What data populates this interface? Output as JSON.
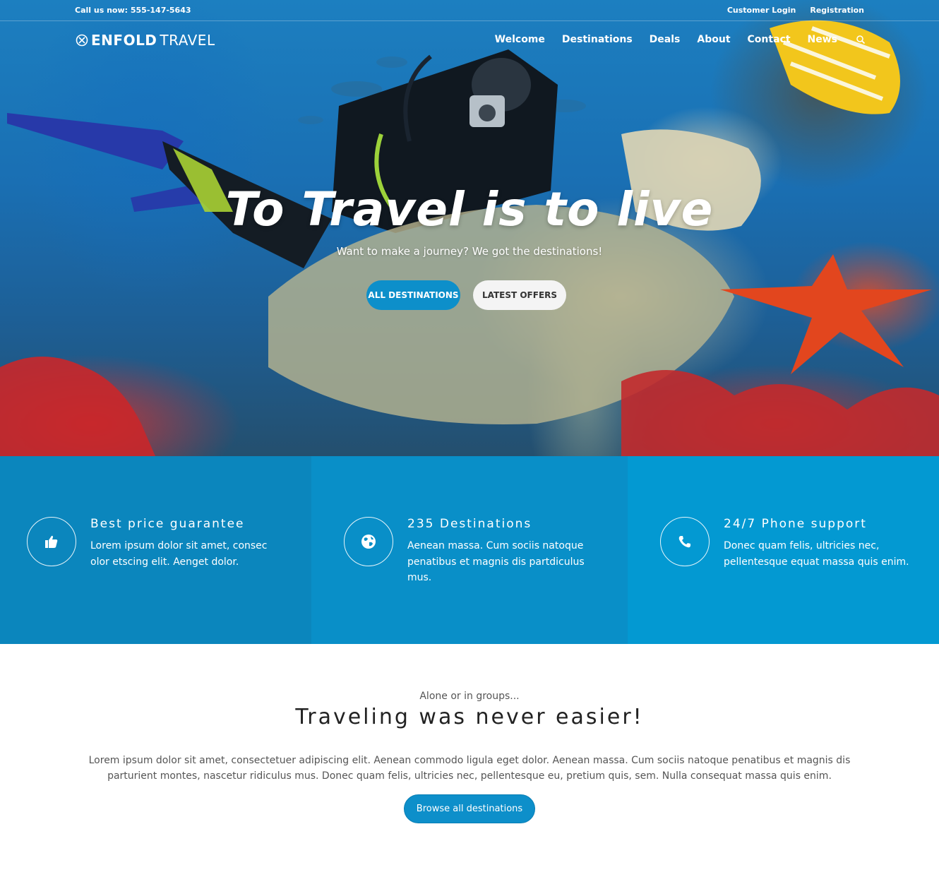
{
  "topbar": {
    "call": "Call us now: 555-147-5643",
    "customer_login": "Customer Login",
    "registration": "Registration"
  },
  "logo": {
    "bold": "ENFOLD",
    "light": "TRAVEL",
    "icon": "compass-icon"
  },
  "nav": {
    "items": [
      "Welcome",
      "Destinations",
      "Deals",
      "About",
      "Contact",
      "News"
    ],
    "search_icon": "search-icon"
  },
  "hero": {
    "headline": "To Travel is to live",
    "subhead": "Want to make a journey? We got the destinations!",
    "btn_all": "ALL DESTINATIONS",
    "btn_offers": "LATEST OFFERS"
  },
  "features": [
    {
      "icon": "thumbs-up-icon",
      "title": "Best price guarantee",
      "text": "Lorem ipsum dolor sit amet, consec olor etscing elit. Aenget dolor."
    },
    {
      "icon": "globe-icon",
      "title": "235 Destinations",
      "text": "Aenean massa. Cum sociis natoque penatibus et magnis dis partdiculus mus."
    },
    {
      "icon": "phone-icon",
      "title": "24/7 Phone support",
      "text": "Donec quam felis, ultricies nec, pellentesque equat massa quis enim."
    }
  ],
  "content": {
    "kicker": "Alone or in groups...",
    "title": "Traveling was never easier!",
    "body": "Lorem ipsum dolor sit amet, consectetuer adipiscing elit. Aenean commodo ligula eget dolor. Aenean massa. Cum sociis natoque penatibus et magnis dis parturient montes, nascetur ridiculus mus. Donec quam felis, ultricies nec, pellentesque eu, pretium quis, sem. Nulla consequat massa quis enim.",
    "button": "Browse all destinations"
  },
  "colors": {
    "accent": "#0d8fca",
    "feature_1": "#0b86bd",
    "feature_2": "#098fc8",
    "feature_3": "#0399d2"
  }
}
